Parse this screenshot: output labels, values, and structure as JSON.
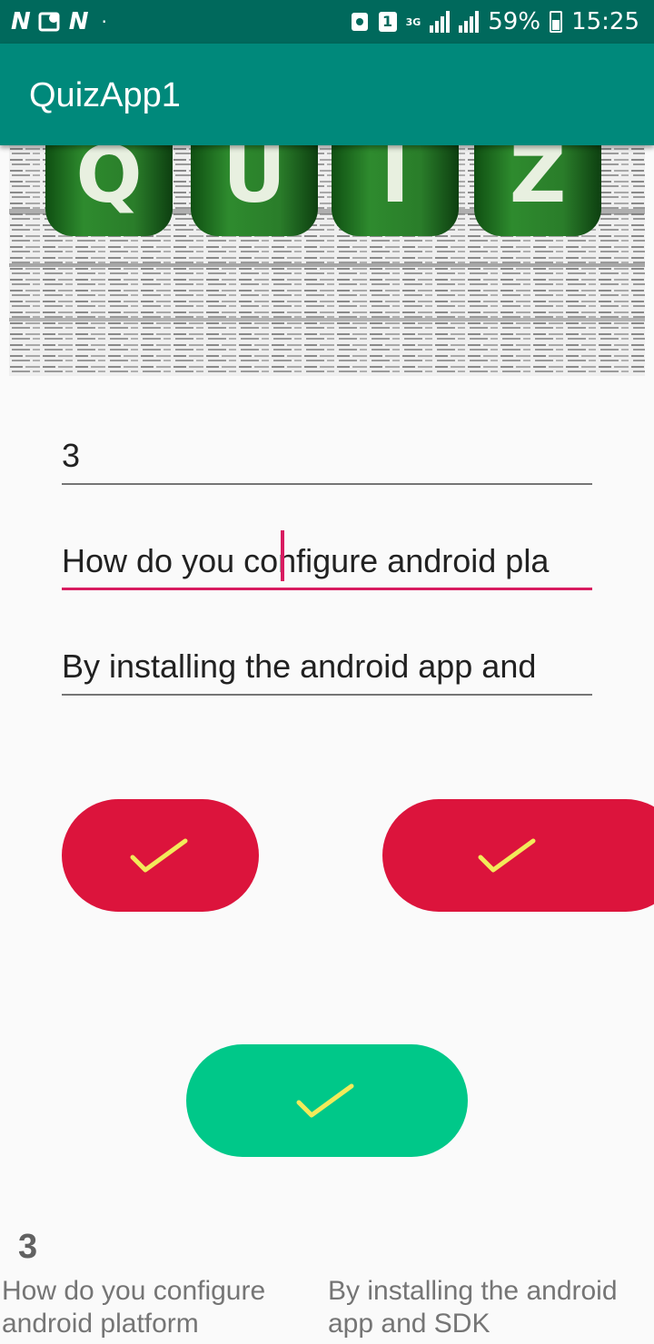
{
  "status_bar": {
    "left_icons": [
      "N",
      "N"
    ],
    "sim_slot": "1",
    "network": "3G",
    "battery": "59%",
    "time": "15:25"
  },
  "app_bar": {
    "title": "QuizApp1"
  },
  "hero": {
    "letters": [
      "Q",
      "U",
      "I",
      "Z"
    ]
  },
  "form": {
    "number_value": "3",
    "question_value": "How do you configure android pla",
    "answer_value": "By installing the android app and"
  },
  "buttons": {
    "icon": "check-icon",
    "colors": {
      "red": "#dc143c",
      "green": "#00c889",
      "check": "#f2ea5a"
    }
  },
  "result": {
    "number": "3",
    "question": "How do you configure android platform",
    "answer": "By installing the android app and SDK"
  }
}
